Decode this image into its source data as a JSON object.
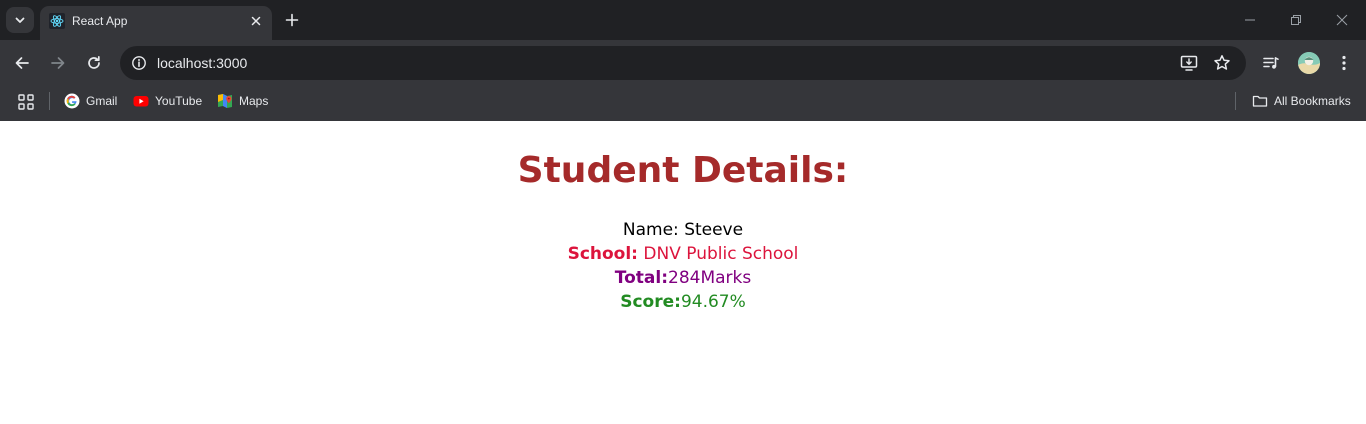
{
  "browser": {
    "tab": {
      "title": "React App"
    },
    "address": {
      "url": "localhost:3000"
    },
    "bookmarks": [
      {
        "label": "Gmail",
        "icon": "google-icon"
      },
      {
        "label": "YouTube",
        "icon": "youtube-icon"
      },
      {
        "label": "Maps",
        "icon": "maps-icon"
      }
    ],
    "all_bookmarks_label": "All Bookmarks"
  },
  "page": {
    "title": "Student Details:",
    "name": {
      "label": "Name:",
      "value": "Steeve"
    },
    "school": {
      "label": "School:",
      "value": "DNV Public School"
    },
    "total": {
      "label": "Total:",
      "value": "284Marks"
    },
    "score": {
      "label": "Score:",
      "value": "94.67%"
    }
  },
  "colors": {
    "title": "#a52a2a",
    "school": "#dc143c",
    "total": "#800080",
    "score": "#228b22",
    "chrome_dark": "#202124",
    "chrome_mid": "#35363a"
  }
}
